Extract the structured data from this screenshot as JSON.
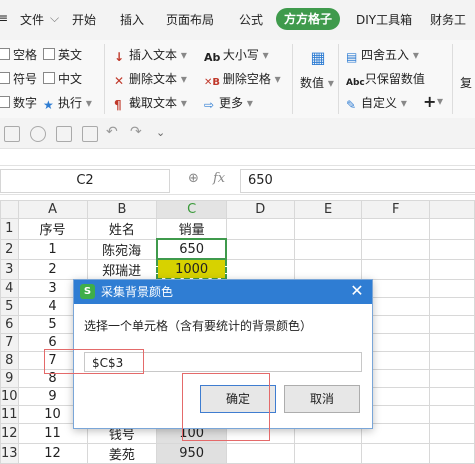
{
  "menu": {
    "items": [
      "文件",
      "开始",
      "插入",
      "页面布局",
      "公式",
      "DIY工具箱",
      "财务工"
    ],
    "active_tab": "方方格子"
  },
  "ribbon": {
    "col1": [
      "空格",
      "符号",
      "数字"
    ],
    "col2": [
      "英文",
      "中文",
      "执行"
    ],
    "col3": [
      "插入文本",
      "删除文本",
      "截取文本"
    ],
    "col4": [
      "大小写",
      "删除空格",
      "更多"
    ],
    "col5": "数值",
    "col6": [
      "四舍五入",
      "只保留数值",
      "自定义"
    ],
    "col7": "复"
  },
  "formula_bar": {
    "cell_ref": "C2",
    "fx_label": "fx",
    "content": "650"
  },
  "sheet": {
    "columns": [
      "A",
      "B",
      "C",
      "D",
      "E",
      "F"
    ],
    "rows": [
      {
        "num": "1",
        "a": "序号",
        "b": "姓名",
        "c": "销量"
      },
      {
        "num": "2",
        "a": "1",
        "b": "陈宛海",
        "c": "650"
      },
      {
        "num": "3",
        "a": "2",
        "b": "郑瑞进",
        "c": "1000"
      },
      {
        "num": "4",
        "a": "3",
        "b": "",
        "c": ""
      },
      {
        "num": "5",
        "a": "4",
        "b": "",
        "c": ""
      },
      {
        "num": "6",
        "a": "5",
        "b": "",
        "c": ""
      },
      {
        "num": "7",
        "a": "6",
        "b": "",
        "c": ""
      },
      {
        "num": "8",
        "a": "7",
        "b": "",
        "c": ""
      },
      {
        "num": "9",
        "a": "8",
        "b": "",
        "c": ""
      },
      {
        "num": "10",
        "a": "9",
        "b": "",
        "c": ""
      },
      {
        "num": "11",
        "a": "10",
        "b": "",
        "c": ""
      },
      {
        "num": "12",
        "a": "11",
        "b": "钱号",
        "c": "100"
      },
      {
        "num": "13",
        "a": "12",
        "b": "姜苑",
        "c": "950"
      }
    ]
  },
  "dialog": {
    "title": "采集背景颜色",
    "logo": "S",
    "description": "选择一个单元格（含有要统计的背景颜色）",
    "input_value": "$C$3",
    "ok_label": "确定",
    "cancel_label": "取消",
    "close_glyph": "✕"
  },
  "colors": {
    "accent_green": "#3f9a4c",
    "dialog_blue": "#2f7dd3",
    "highlight_yellow": "#d7d200"
  }
}
